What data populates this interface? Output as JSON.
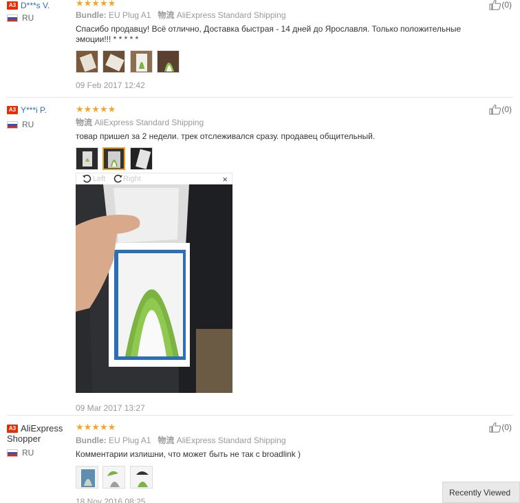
{
  "reviews": [
    {
      "badge": "A3",
      "user": "D***s V.",
      "country": "RU",
      "stars": "★★★★★",
      "bundle_label": "Bundle:",
      "bundle_value": "EU Plug A1",
      "logistics_label": "物流",
      "logistics_value": "AliExpress Standard Shipping",
      "text": "Спасибо продавцу! Всё отлично, Доставка быстрая - 14 дней до Ярославля. Только положительные эмоции!!! * * * * *",
      "date": "09 Feb 2017 12:42",
      "likes": "(0)"
    },
    {
      "badge": "A3",
      "user": "Y***i P.",
      "country": "RU",
      "stars": "★★★★★",
      "logistics_label": "物流",
      "logistics_value": "AliExpress Standard Shipping",
      "text": "товар пришел за 2 недели. трек отслеживался сразу. продавец общительный.",
      "date": "09 Mar 2017 13:27",
      "likes": "(0)",
      "viewer": {
        "left": "Left",
        "right": "Right",
        "close": "×"
      }
    },
    {
      "badge": "A3",
      "user": "AliExpress Shopper",
      "country": "RU",
      "stars": "★★★★★",
      "bundle_label": "Bundle:",
      "bundle_value": "EU Plug A1",
      "logistics_label": "物流",
      "logistics_value": "AliExpress Standard Shipping",
      "text": "Комментарии излишни, что может быть не так с broadlink )",
      "date": "18 Nov 2016 08:25",
      "likes": "(0)"
    }
  ],
  "recently_viewed": "Recently Viewed"
}
